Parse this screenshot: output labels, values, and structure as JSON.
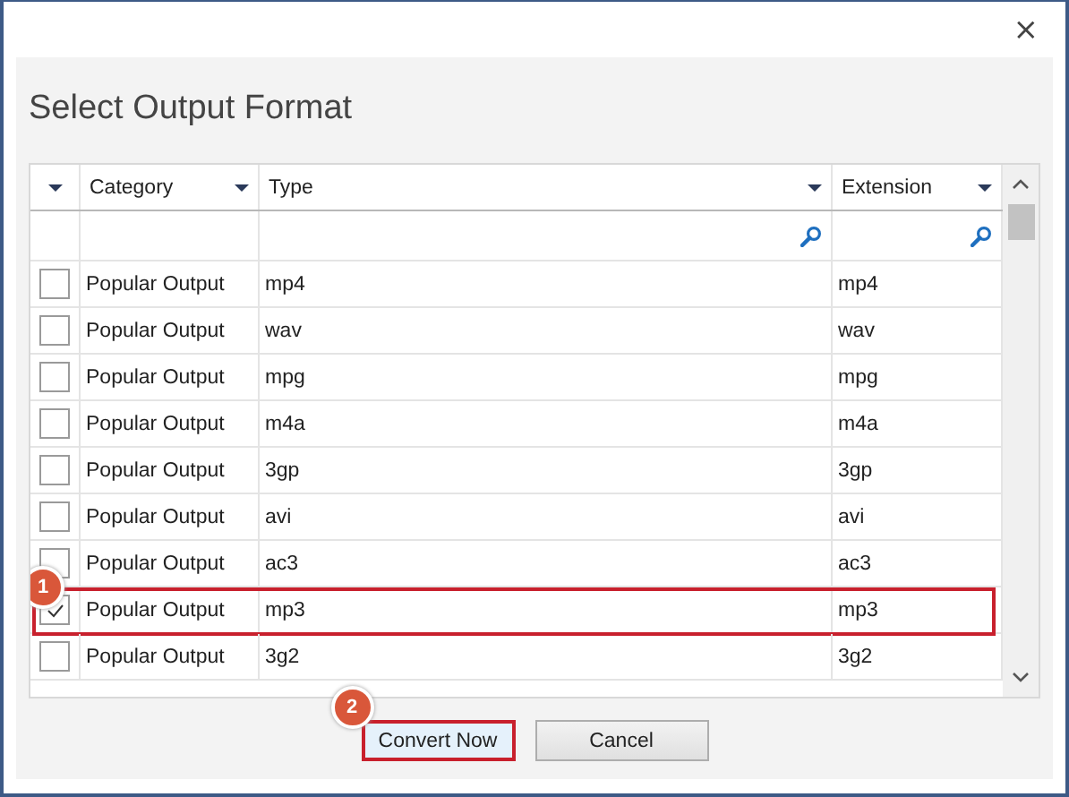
{
  "window": {
    "close": "×"
  },
  "title": "Select Output Format",
  "table": {
    "columns": [
      "Category",
      "Type",
      "Extension"
    ],
    "rows": [
      {
        "category": "Popular Output",
        "type": "mp4",
        "extension": "mp4",
        "checked": false,
        "marked": false
      },
      {
        "category": "Popular Output",
        "type": "wav",
        "extension": "wav",
        "checked": false,
        "marked": false
      },
      {
        "category": "Popular Output",
        "type": "mpg",
        "extension": "mpg",
        "checked": false,
        "marked": false
      },
      {
        "category": "Popular Output",
        "type": "m4a",
        "extension": "m4a",
        "checked": false,
        "marked": false
      },
      {
        "category": "Popular Output",
        "type": "3gp",
        "extension": "3gp",
        "checked": false,
        "marked": false
      },
      {
        "category": "Popular Output",
        "type": "avi",
        "extension": "avi",
        "checked": false,
        "marked": false
      },
      {
        "category": "Popular Output",
        "type": "ac3",
        "extension": "ac3",
        "checked": false,
        "marked": false
      },
      {
        "category": "Popular Output",
        "type": "mp3",
        "extension": "mp3",
        "checked": true,
        "marked": true,
        "step": "1"
      },
      {
        "category": "Popular Output",
        "type": "3g2",
        "extension": "3g2",
        "checked": false,
        "marked": false
      }
    ]
  },
  "buttons": [
    {
      "label": "Convert Now",
      "marked": true,
      "step": "2"
    },
    {
      "label": "Cancel",
      "marked": false
    }
  ]
}
